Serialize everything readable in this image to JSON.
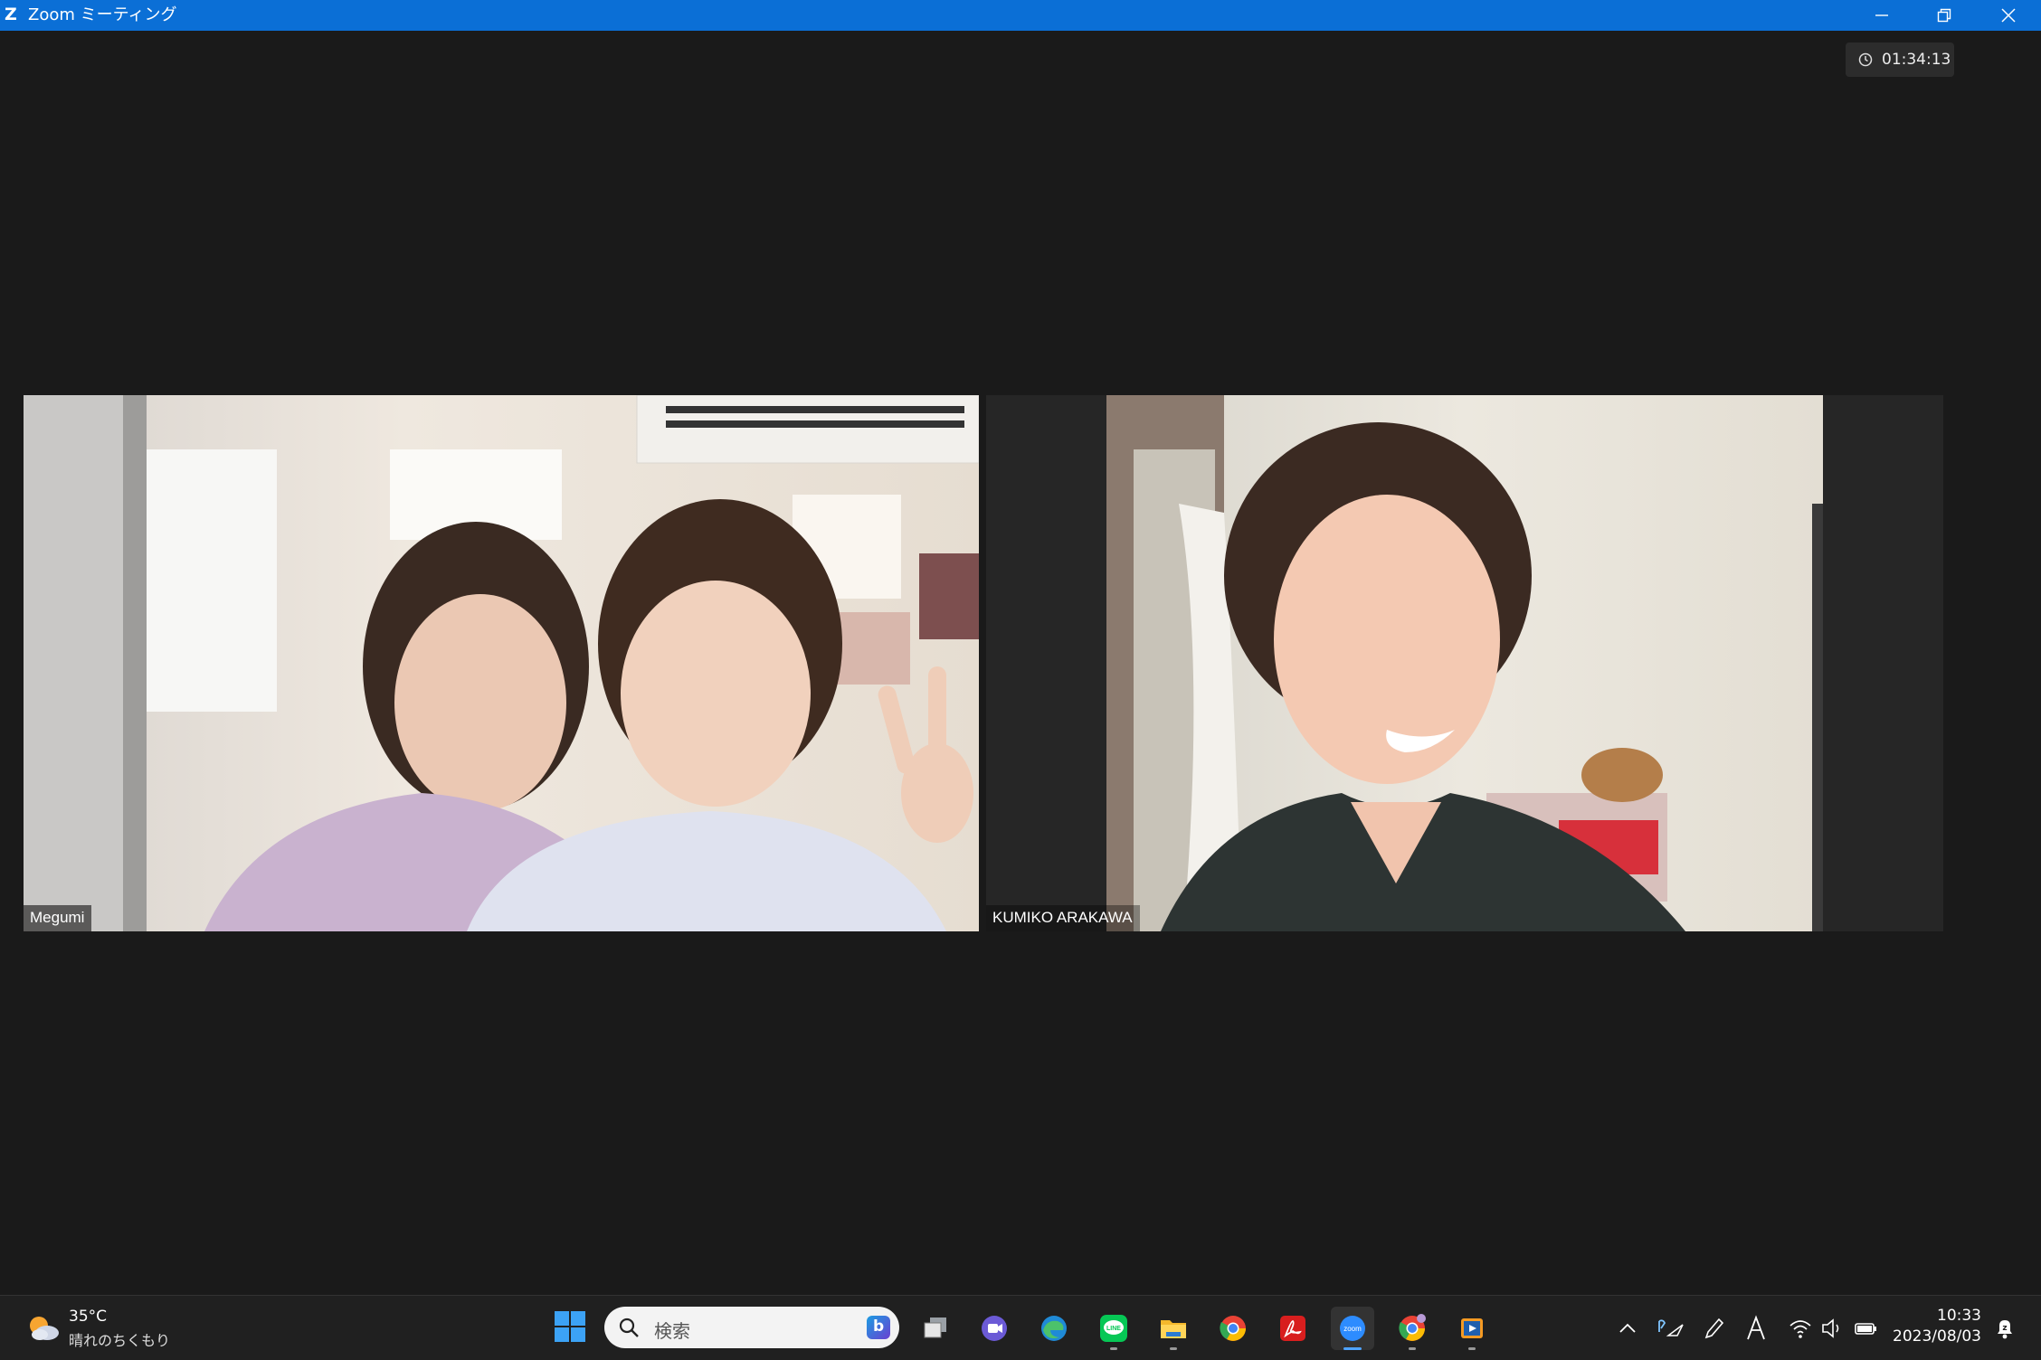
{
  "window": {
    "title": "Zoom ミーティング",
    "app_icon": "zoom-logo-icon"
  },
  "meeting": {
    "timer": "01:34:13",
    "participants": [
      {
        "name": "Megumi"
      },
      {
        "name": "KUMIKO ARAKAWA"
      }
    ]
  },
  "taskbar": {
    "weather": {
      "temperature": "35°C",
      "condition": "晴れのちくもり",
      "icon": "partly-cloudy-sun-icon"
    },
    "search": {
      "placeholder": "検索"
    },
    "apps": [
      {
        "name": "task-view",
        "icon": "task-view-icon"
      },
      {
        "name": "teams-chat",
        "icon": "chat-icon"
      },
      {
        "name": "edge",
        "icon": "edge-icon"
      },
      {
        "name": "line",
        "icon": "line-icon",
        "label": "LINE"
      },
      {
        "name": "file-explorer",
        "icon": "folder-icon"
      },
      {
        "name": "chrome",
        "icon": "chrome-icon"
      },
      {
        "name": "acrobat",
        "icon": "acrobat-icon"
      },
      {
        "name": "zoom",
        "icon": "zoom-icon",
        "label": "zoom",
        "active": true
      },
      {
        "name": "chrome-profile",
        "icon": "chrome-icon"
      },
      {
        "name": "media-player",
        "icon": "media-player-icon"
      }
    ],
    "clock": {
      "time": "10:33",
      "date": "2023/08/03"
    }
  },
  "colors": {
    "titlebar": "#0b6fd6",
    "background": "#1a1a1a",
    "taskbar": "#202020"
  }
}
